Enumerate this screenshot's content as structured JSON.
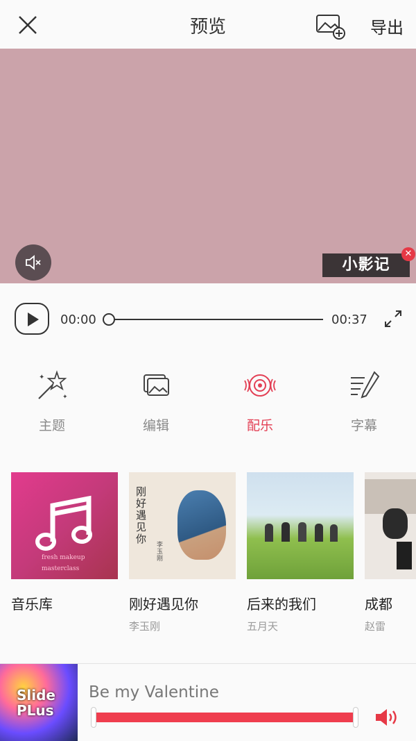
{
  "header": {
    "title": "预览",
    "export_label": "导出"
  },
  "preview": {
    "watermark_label": "小影记"
  },
  "player": {
    "current_time": "00:00",
    "duration": "00:37",
    "progress": 0
  },
  "tabs": [
    {
      "label": "主题",
      "icon": "magic-wand-icon",
      "active": false
    },
    {
      "label": "编辑",
      "icon": "image-edit-icon",
      "active": false
    },
    {
      "label": "配乐",
      "icon": "music-disc-icon",
      "active": true
    },
    {
      "label": "字幕",
      "icon": "subtitle-pen-icon",
      "active": false
    }
  ],
  "albums": [
    {
      "name": "音乐库",
      "artist": "",
      "cover_text": [
        "fresh makeup",
        "masterclass"
      ]
    },
    {
      "name": "刚好遇见你",
      "artist": "李玉刚",
      "cover_text": [
        "刚好遇见你",
        "李玉刚"
      ]
    },
    {
      "name": "后来的我们",
      "artist": "五月天",
      "cover_text": []
    },
    {
      "name": "成都",
      "artist": "赵雷",
      "cover_text": []
    }
  ],
  "music": {
    "song_title": "Be my Valentine",
    "thumb_text": [
      "Slide",
      "PLus"
    ]
  },
  "colors": {
    "accent": "#e34055",
    "preview_bg": "#cba3aa",
    "range": "#ef3d4e"
  }
}
